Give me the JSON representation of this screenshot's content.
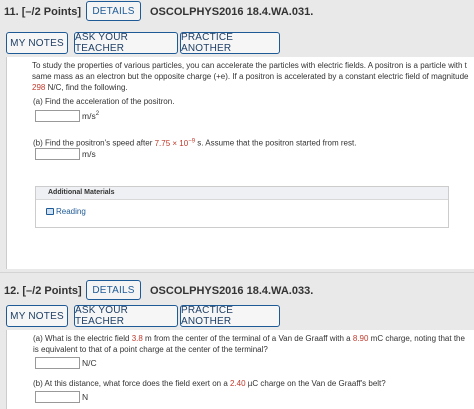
{
  "q11": {
    "number": "11.",
    "points": "[–/2 Points]",
    "details_label": "DETAILS",
    "id": "OSCOLPHYS2016 18.4.WA.031.",
    "buttons": {
      "my_notes": "MY NOTES",
      "ask_teacher": "ASK YOUR TEACHER",
      "practice": "PRACTICE ANOTHER"
    },
    "intro_line1": "To study the properties of various particles, you can accelerate the particles with electric fields. A positron is a particle with t",
    "intro_line2": "same mass as an electron but the opposite charge (+e). If a positron is accelerated by a constant electric field of magnitude",
    "field_value": "298",
    "intro_line3_rest": " N/C, find the following.",
    "part_a": "(a) Find the acceleration of the positron.",
    "part_a_unit": "m/s",
    "part_a_unit_sup": "2",
    "part_b_pre": "(b) Find the positron's speed after ",
    "part_b_value": "7.75 × 10",
    "part_b_exp": "−9",
    "part_b_post": " s. Assume that the positron started from rest.",
    "part_b_unit": "m/s",
    "additional_materials": "Additional Materials",
    "reading": "Reading"
  },
  "q12": {
    "number": "12.",
    "points": "[–/2 Points]",
    "details_label": "DETAILS",
    "id": "OSCOLPHYS2016 18.4.WA.033.",
    "buttons": {
      "my_notes": "MY NOTES",
      "ask_teacher": "ASK YOUR TEACHER",
      "practice": "PRACTICE ANOTHER"
    },
    "part_a_pre": "(a) What is the electric field ",
    "distance": "3.8",
    "part_a_mid": " m from the center of the terminal of a Van de Graaff with a ",
    "charge": "8.90",
    "part_a_post": " mC charge, noting that the",
    "part_a_line2": "is equivalent to that of a point charge at the center of the terminal?",
    "part_a_unit": "N/C",
    "part_b_pre": "(b) At this distance, what force does the field exert on a ",
    "small_charge": "2.40",
    "part_b_post": " µC charge on the Van de Graaff's belt?",
    "part_b_unit": "N"
  },
  "colors": {
    "accent": "#1e5a96",
    "highlight": "#c0392b",
    "background": "#e9e9e9"
  },
  "icons": {
    "reading": "book-icon"
  }
}
